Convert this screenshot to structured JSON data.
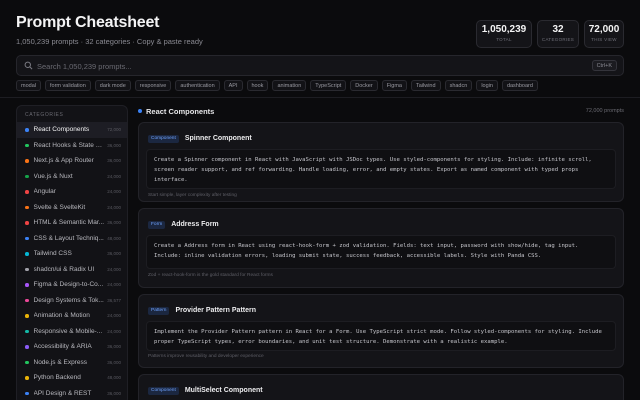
{
  "header": {
    "title": "Prompt Cheatsheet",
    "subtitle": "1,050,239 prompts · 32 categories · Copy & paste ready",
    "stats": [
      {
        "value": "1,050,239",
        "label": "TOTAL"
      },
      {
        "value": "32",
        "label": "CATEGORIES"
      },
      {
        "value": "72,000",
        "label": "THIS VIEW"
      }
    ]
  },
  "search": {
    "placeholder": "Search 1,050,239 prompts...",
    "value": "",
    "shortcut": "Ctrl+K"
  },
  "tags": [
    "modal",
    "form validation",
    "dark mode",
    "responsive",
    "authentication",
    "API",
    "hook",
    "animation",
    "TypeScript",
    "Docker",
    "Figma",
    "Tailwind",
    "shadcn",
    "login",
    "dashboard"
  ],
  "sidebar": {
    "heading": "CATEGORIES",
    "items": [
      {
        "label": "React Components",
        "count": "72,000",
        "color": "#3b82f6",
        "active": true
      },
      {
        "label": "React Hooks & State Ma...",
        "count": "36,000",
        "color": "#22c55e",
        "active": false
      },
      {
        "label": "Next.js & App Router",
        "count": "36,000",
        "color": "#f97316",
        "active": false
      },
      {
        "label": "Vue.js & Nuxt",
        "count": "24,000",
        "color": "#16a34a",
        "active": false
      },
      {
        "label": "Angular",
        "count": "24,000",
        "color": "#ef4444",
        "active": false
      },
      {
        "label": "Svelte & SvelteKit",
        "count": "24,000",
        "color": "#f97316",
        "active": false
      },
      {
        "label": "HTML & Semantic Mar...",
        "count": "36,000",
        "color": "#ef4444",
        "active": false
      },
      {
        "label": "CSS & Layout Techniq...",
        "count": "48,000",
        "color": "#3b82f6",
        "active": false
      },
      {
        "label": "Tailwind CSS",
        "count": "36,000",
        "color": "#06b6d4",
        "active": false
      },
      {
        "label": "shadcn/ui & Radix UI",
        "count": "24,000",
        "color": "#a1a1aa",
        "active": false
      },
      {
        "label": "Figma & Design-to-Co...",
        "count": "24,000",
        "color": "#a855f7",
        "active": false
      },
      {
        "label": "Design Systems & Tok...",
        "count": "36,577",
        "color": "#ec4899",
        "active": false
      },
      {
        "label": "Animation & Motion",
        "count": "24,000",
        "color": "#eab308",
        "active": false
      },
      {
        "label": "Responsive & Mobile-...",
        "count": "24,000",
        "color": "#14b8a6",
        "active": false
      },
      {
        "label": "Accessibility & ARIA",
        "count": "36,000",
        "color": "#8b5cf6",
        "active": false
      },
      {
        "label": "Node.js & Express",
        "count": "36,000",
        "color": "#22c55e",
        "active": false
      },
      {
        "label": "Python Backend",
        "count": "48,000",
        "color": "#eab308",
        "active": false
      },
      {
        "label": "API Design & REST",
        "count": "36,000",
        "color": "#3b82f6",
        "active": false
      }
    ]
  },
  "main": {
    "section_title": "React Components",
    "section_count": "72,000 prompts",
    "cards": [
      {
        "badge": "Component",
        "title": "Spinner Component",
        "prompt": "Create a Spinner component in React with JavaScript with JSDoc types. Use styled-components for styling. Include: infinite scroll, screen reader support, and ref forwarding. Handle loading, error, and empty states. Export as named component with typed props interface.",
        "note": "Start simple, layer complexity after testing"
      },
      {
        "badge": "Form",
        "title": "Address Form",
        "prompt": "Create a Address form in React using react-hook-form + zod validation. Fields: text input, password with show/hide, tag input. Include: inline validation errors, loading submit state, success feedback, accessible labels. Style with Panda CSS.",
        "note": "Zod + react-hook-form is the gold standard for React forms"
      },
      {
        "badge": "Pattern",
        "title": "Provider Pattern Pattern",
        "prompt": "Implement the Provider Pattern pattern in React for a Form. Use TypeScript strict mode. Follow styled-components for styling. Include proper TypeScript types, error boundaries, and unit test structure. Demonstrate with a realistic example.",
        "note": "Patterns improve reusability and developer experience"
      },
      {
        "badge": "Component",
        "title": "MultiSelect Component",
        "prompt": "",
        "note": ""
      }
    ]
  }
}
